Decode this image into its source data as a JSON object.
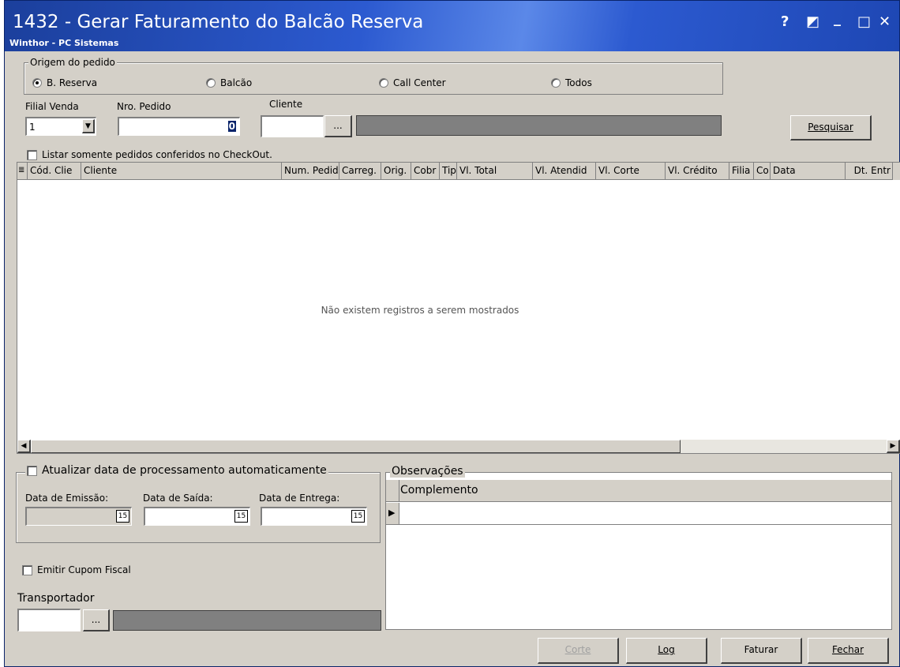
{
  "window": {
    "title": "1432 - Gerar Faturamento do Balcão Reserva",
    "subtitle": "Winthor - PC Sistemas",
    "controls": {
      "help": "?",
      "restore": "◩",
      "minimize": "_",
      "maximize": "□",
      "close": "✕"
    }
  },
  "origem": {
    "group_label": "Origem do pedido",
    "options": [
      "B. Reserva",
      "Balcão",
      "Call Center",
      "Todos"
    ],
    "selected": "B. Reserva"
  },
  "filters": {
    "filial_label": "Filial Venda",
    "filial_value": "1",
    "nro_pedido_label": "Nro. Pedido",
    "nro_pedido_value": "0",
    "cliente_label": "Cliente",
    "cliente_value": "",
    "browse_label": "...",
    "search_button": "Pesquisar",
    "checkout_checkbox": "Listar somente pedidos conferidos no CheckOut."
  },
  "grid": {
    "columns": [
      "Cód. Clie",
      "Cliente",
      "Num. Pedido",
      "Carreg.",
      "Orig.",
      "Cobr",
      "Tipo",
      "Vl. Total",
      "Vl. Atendid",
      "Vl. Corte",
      "Vl. Crédito",
      "Filia",
      "Co",
      "Data",
      "Dt. Entr"
    ],
    "empty_message": "Não existem registros a serem mostrados"
  },
  "dates": {
    "group_label": "Atualizar data de processamento automaticamente",
    "emissao_label": "Data de Emissão:",
    "saida_label": "Data de Saída:",
    "entrega_label": "Data de Entrega:",
    "cal_icon": "15"
  },
  "cupom": {
    "label": "Emitir Cupom Fiscal"
  },
  "transportador": {
    "label": "Transportador",
    "browse_label": "..."
  },
  "observacoes": {
    "group_label": "Observações",
    "column": "Complemento"
  },
  "buttons": {
    "corte": "Corte",
    "log": "Log",
    "faturar": "Faturar",
    "fechar": "Fechar"
  }
}
